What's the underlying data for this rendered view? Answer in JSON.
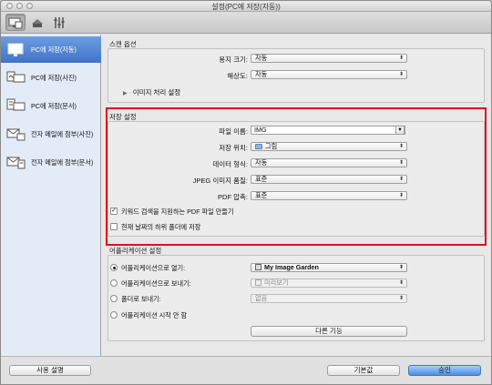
{
  "window": {
    "title": "설정(PC에 저장(자동))"
  },
  "toolbar": {
    "tabs": [
      {
        "icon": "scan-from-computer-icon"
      },
      {
        "icon": "scan-from-operation-panel-icon"
      },
      {
        "icon": "general-settings-icon"
      }
    ]
  },
  "sidebar": {
    "items": [
      {
        "label": "PC에 저장(자동)",
        "icon": "monitor-icon"
      },
      {
        "label": "PC에 저장(사진)",
        "icon": "photo-to-pc-icon"
      },
      {
        "label": "PC에 저장(문서)",
        "icon": "document-to-pc-icon"
      },
      {
        "label": "전자 메일에 첨부(사진)",
        "icon": "mail-photo-icon"
      },
      {
        "label": "전자 메일에 첨부(문서)",
        "icon": "mail-document-icon"
      }
    ]
  },
  "scan_options": {
    "title": "스캔 옵션",
    "paper_size_label": "용지 크기:",
    "paper_size_value": "자동",
    "resolution_label": "해상도:",
    "resolution_value": "자동",
    "image_processing_label": "이미지 처리 설정"
  },
  "save_settings": {
    "title": "저장 설정",
    "file_name_label": "파일 이름:",
    "file_name_value": "IMG",
    "save_in_label": "저장 위치:",
    "save_in_value": "그림",
    "data_format_label": "데이터 형식:",
    "data_format_value": "자동",
    "jpeg_quality_label": "JPEG 이미지 품질:",
    "jpeg_quality_value": "표준",
    "pdf_compression_label": "PDF 압축:",
    "pdf_compression_value": "표준",
    "keyword_pdf_label": "키워드 검색을 지원하는 PDF 파일 만들기",
    "keyword_pdf_checked": true,
    "subfolder_label": "현재 날짜의 하위 폴더에 저장",
    "subfolder_checked": false
  },
  "app_settings": {
    "title": "어플리케이션 설정",
    "open_with_label": "어플리케이션으로 열기:",
    "open_with_value": "My Image Garden",
    "send_to_app_label": "어플리케이션으로 보내기:",
    "send_to_app_value": "미리보기",
    "send_to_folder_label": "폴더로 보내기:",
    "send_to_folder_value": "없음",
    "do_not_start_label": "어플리케이션 시작 안 함",
    "more_functions_label": "다른 기능"
  },
  "footer": {
    "help_label": "사용 설명",
    "defaults_label": "기본값",
    "ok_label": "승인"
  },
  "colors": {
    "highlight": "#e01018",
    "sidebar_selected": "#3f73c6",
    "ok_button": "#4c8fe3"
  }
}
